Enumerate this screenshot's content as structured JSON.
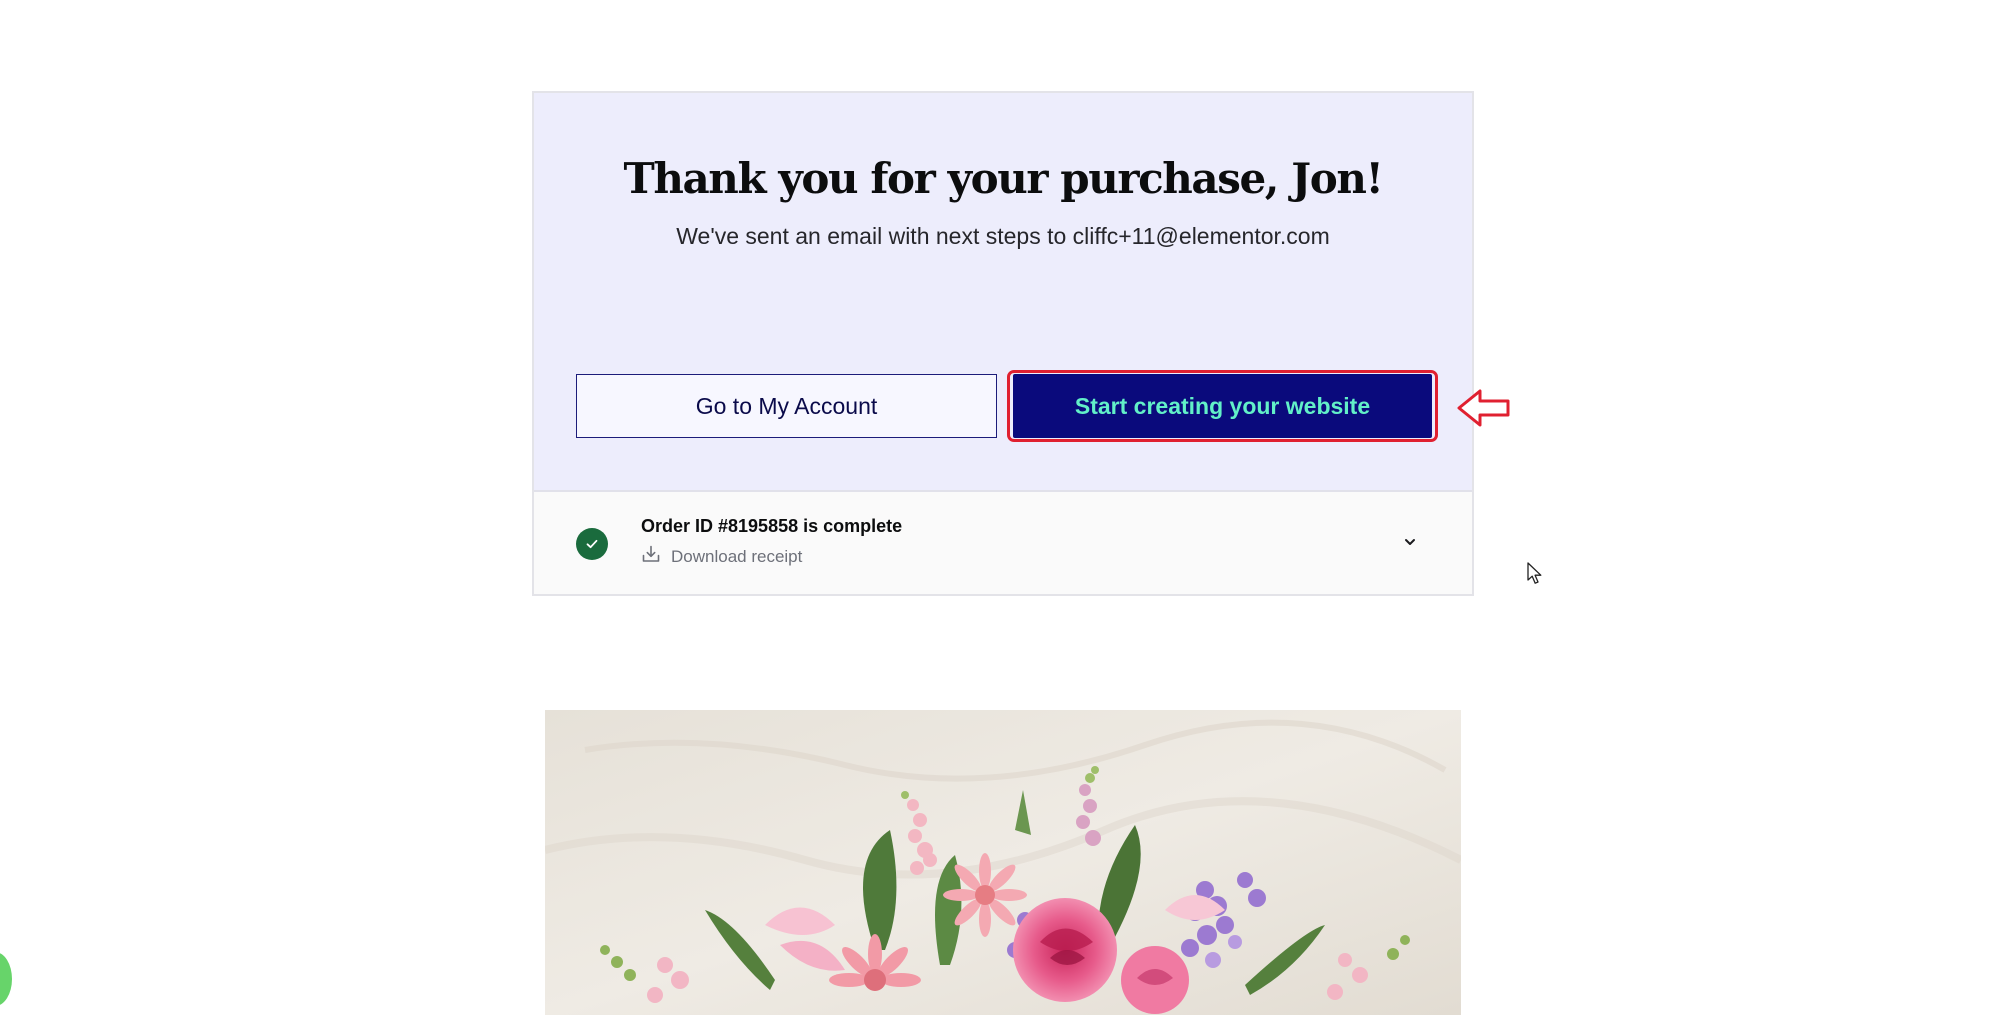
{
  "confirmation": {
    "heading": "Thank you for your purchase, Jon!",
    "subtext": "We've sent an email with next steps to cliffc+11@elementor.com"
  },
  "buttons": {
    "my_account": "Go to My Account",
    "start_creating": "Start creating your website"
  },
  "order": {
    "status_text": "Order ID #8195858 is complete",
    "download_label": "Download receipt"
  },
  "icons": {
    "check": "check-circle-icon",
    "download": "download-icon",
    "expand": "chevron-down-icon",
    "annotation": "left-arrow-icon",
    "cursor": "mouse-pointer-icon"
  },
  "colors": {
    "card_top_bg": "#ededfc",
    "primary_button_bg": "#0a0a7c",
    "primary_button_text": "#62f0c8",
    "highlight_ring": "#e02030",
    "success_green": "#1a6b3d"
  }
}
